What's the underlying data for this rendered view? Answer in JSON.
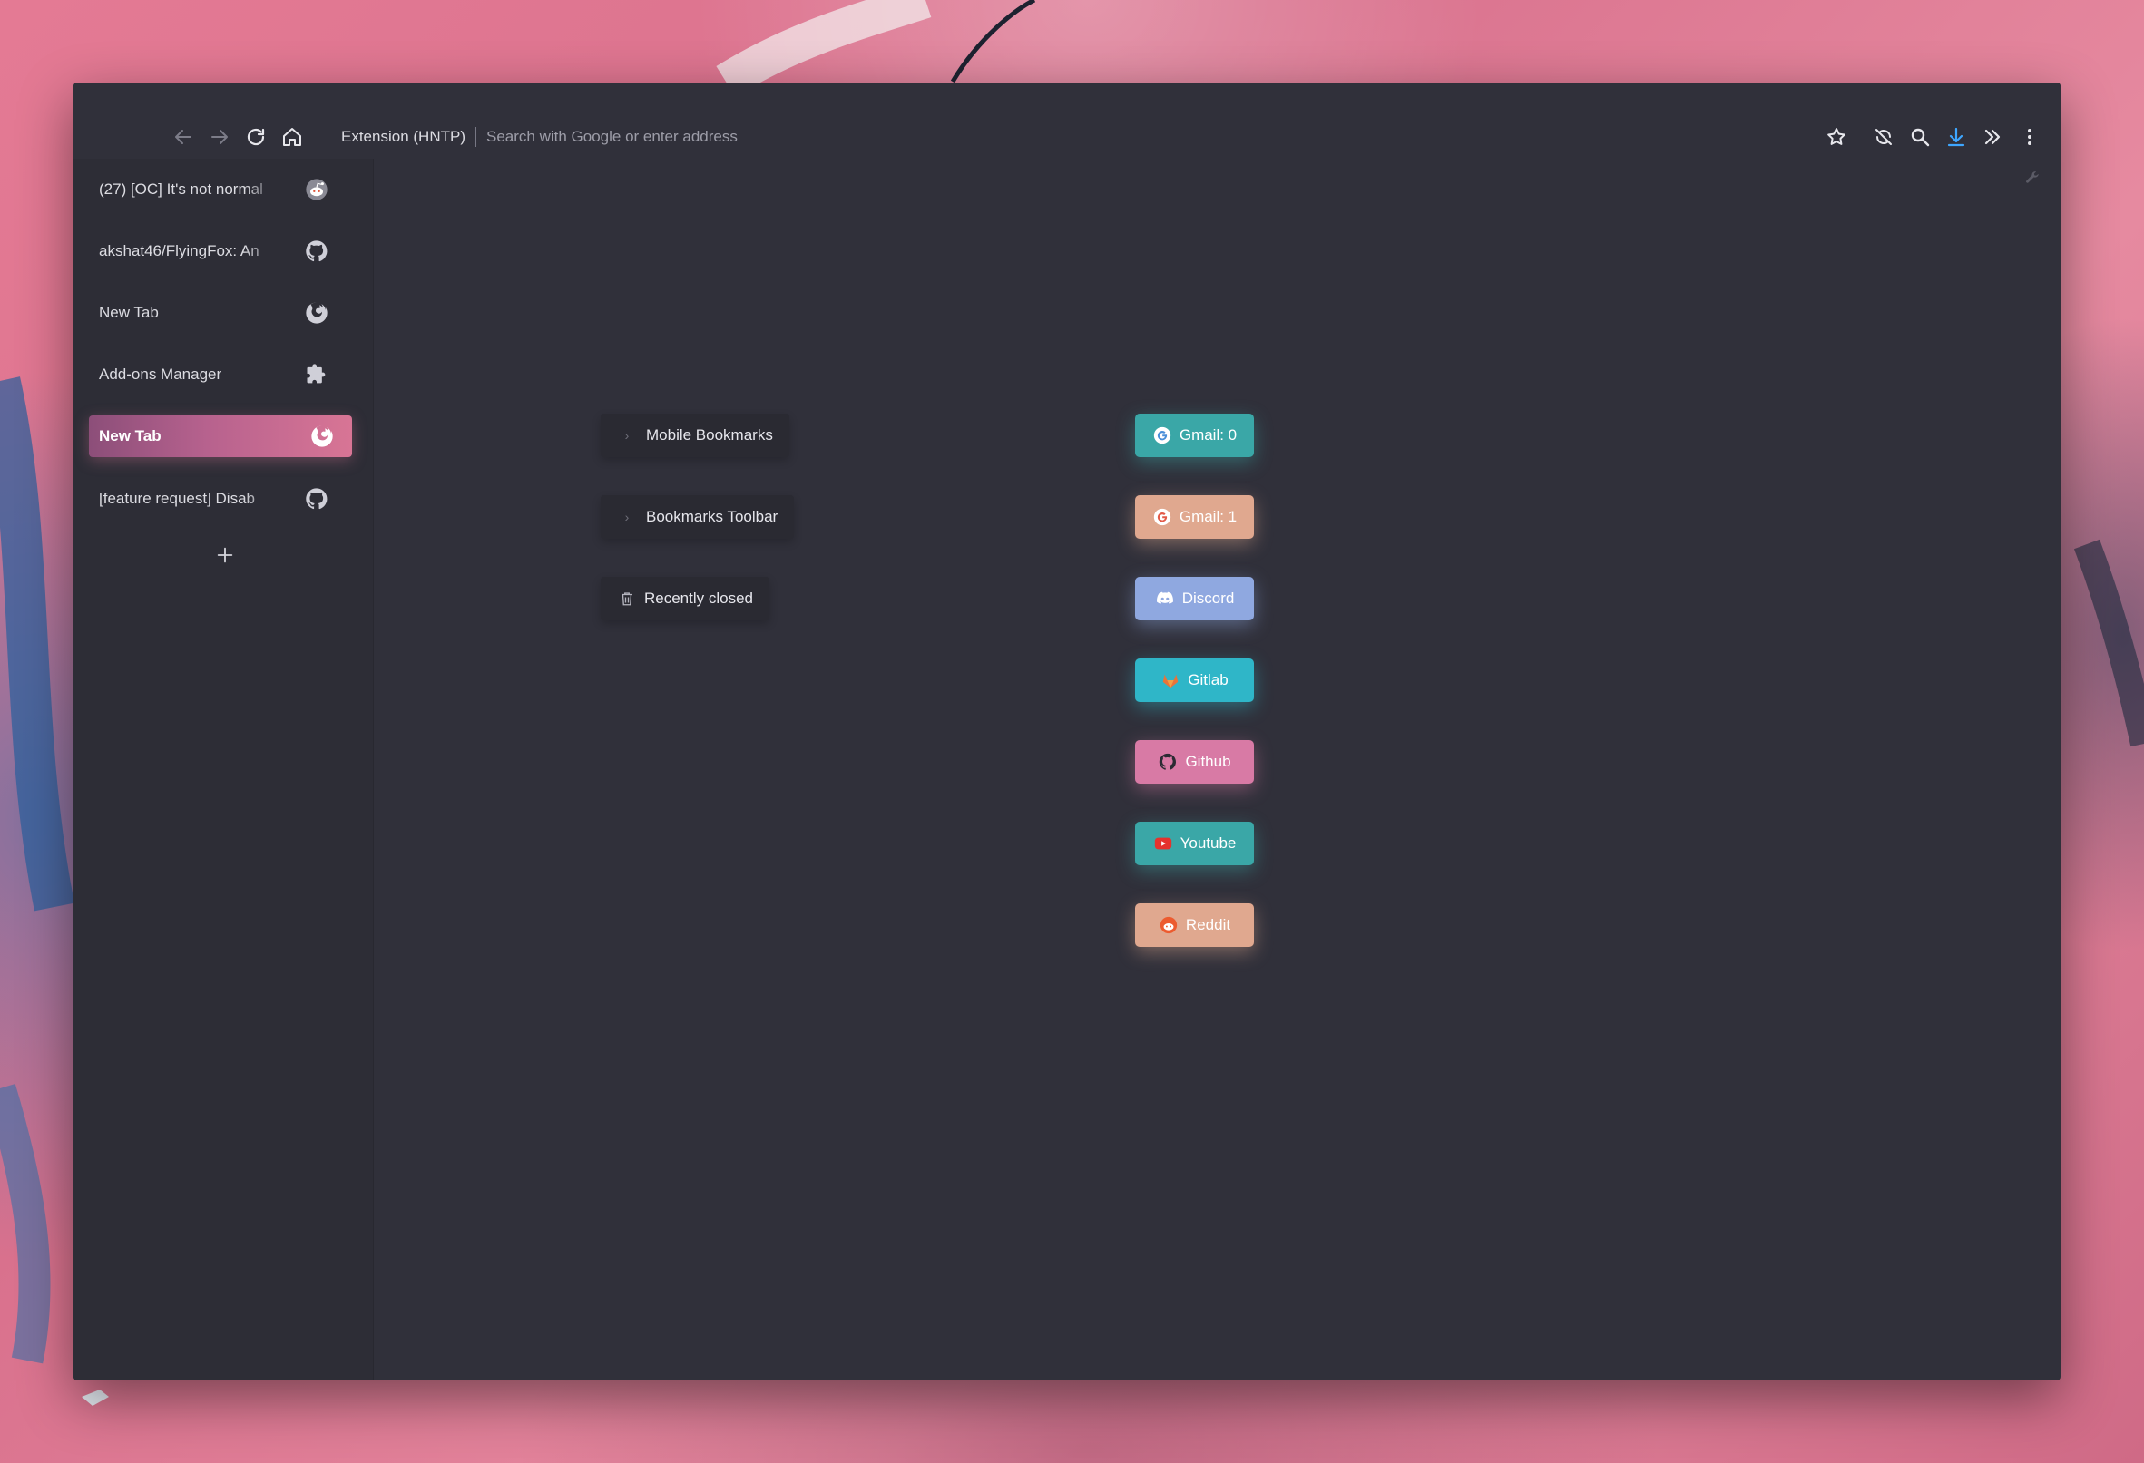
{
  "toolbar": {
    "url_extension_label": "Extension (HNTP)",
    "url_placeholder": "Search with Google or enter address",
    "icons": [
      "back-icon",
      "forward-icon",
      "reload-icon",
      "home-icon",
      "bookmark-star-icon",
      "sync-off-icon",
      "search-icon",
      "download-icon",
      "overflow-chevrons-icon",
      "menu-kebab-icon"
    ],
    "accent_color": "#3ea6ff"
  },
  "sidebar": {
    "tabs": [
      {
        "title": "(27) [OC] It's not normal",
        "icon": "reddit-icon",
        "active": false
      },
      {
        "title": "akshat46/FlyingFox: An",
        "icon": "github-icon",
        "active": false
      },
      {
        "title": "New Tab",
        "icon": "firefox-icon",
        "active": false
      },
      {
        "title": "Add-ons Manager",
        "icon": "puzzle-icon",
        "active": false
      },
      {
        "title": "New Tab",
        "icon": "firefox-icon",
        "active": true
      },
      {
        "title": "[feature request] Disab",
        "icon": "github-icon",
        "active": false
      }
    ],
    "new_tab_icon": "plus-icon",
    "active_color": "#d87595"
  },
  "folders": [
    {
      "label": "Mobile Bookmarks",
      "icon": "chevron-right-icon"
    },
    {
      "label": "Bookmarks Toolbar",
      "icon": "chevron-right-icon"
    },
    {
      "label": "Recently closed",
      "icon": "trash-icon"
    }
  ],
  "bookmarks": [
    {
      "label": "Gmail: 0",
      "icon": "google-icon",
      "color": "#3aa7a7"
    },
    {
      "label": "Gmail: 1",
      "icon": "google-icon",
      "color": "#e0a88f"
    },
    {
      "label": "Discord",
      "icon": "discord-icon",
      "color": "#8fa8e0"
    },
    {
      "label": "Gitlab",
      "icon": "gitlab-icon",
      "color": "#2fb6c8"
    },
    {
      "label": "Github",
      "icon": "github-icon",
      "color": "#d87aa5"
    },
    {
      "label": "Youtube",
      "icon": "youtube-icon",
      "color": "#3aa7a7"
    },
    {
      "label": "Reddit",
      "icon": "reddit-icon",
      "color": "#e0a88f"
    }
  ],
  "window_controls": {
    "colors": [
      "#e8a77e",
      "#6fd6b6",
      "#e06a86"
    ]
  }
}
